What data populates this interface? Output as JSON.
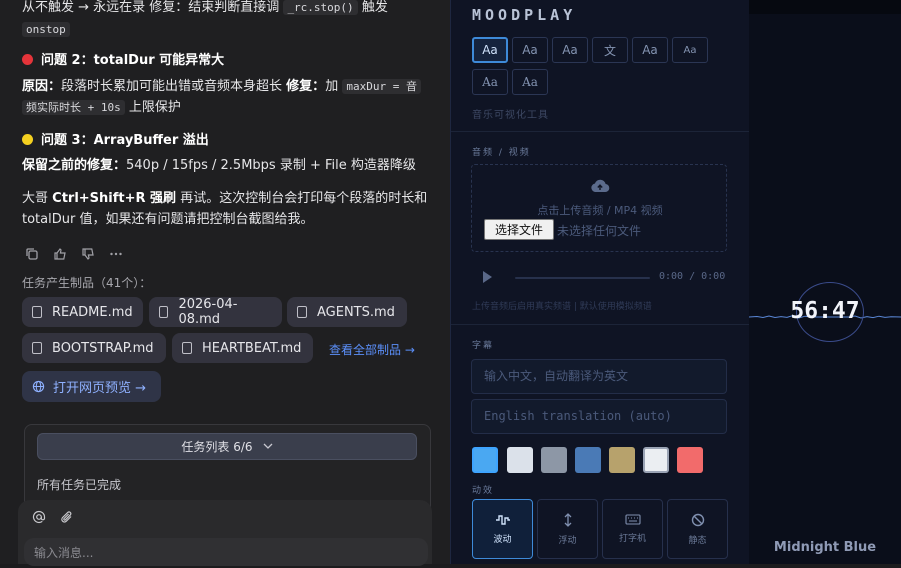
{
  "chat": {
    "line1": "从不触发 → 永远在录 修复：结束判断直接调",
    "code1": "_rc.stop()",
    "line1b": "触发",
    "code2": "onstop",
    "issue2_title": "问题 2：totalDur 可能异常大",
    "issue2_cause_label": "原因：",
    "issue2_cause": "段落时长累加可能出错或音频本身超长",
    "issue2_fix_label": "修复：",
    "issue2_fix_pre": "加",
    "issue2_code": "maxDur = 音",
    "issue2_code_b": "频实际时长 + 10s",
    "issue2_tail": "上限保护",
    "issue3_title": "问题 3：ArrayBuffer 溢出",
    "issue3_label": "保留之前的修复：",
    "issue3_text": "540p / 15fps / 2.5Mbps 录制 + File 构造器降级",
    "closing1_pre": "大哥",
    "closing1_keys": "Ctrl+Shift+R 强刷",
    "closing1_post": "再试。这次控制台会打印每个段落的时长和",
    "closing2": "totalDur 值，如果还有问题请把控制台截图给我。",
    "artifacts_title": "任务产生制品（41个）：",
    "artifacts": [
      "README.md",
      "2026-04-08.md",
      "AGENTS.md",
      "BOOTSTRAP.md",
      "HEARTBEAT.md"
    ],
    "view_all": "查看全部制品 →",
    "preview": "打开网页预览 →",
    "tasks_header": "任务列表 6/6",
    "tasks_done": "所有任务已完成",
    "composer_placeholder": "输入消息..."
  },
  "panel": {
    "logo": "MOODPLAY",
    "fonts": [
      "Aa",
      "Aa",
      "Aa",
      "文",
      "Aa",
      "Aa",
      "Aa",
      "Aa"
    ],
    "subtitle": "音乐可视化工具",
    "audio_section": "音频 / 视频",
    "upload_text": "点击上传音频 / MP4 视频",
    "choose_file": "选择文件",
    "no_file": "未选择任何文件",
    "time": "0:00 / 0:00",
    "upload_hint": "上传音频后启用真实频谱 | 默认使用模拟频谱",
    "subtitle_section": "字幕",
    "zh_placeholder": "输入中文，自动翻译为英文",
    "en_placeholder": "English translation (auto)",
    "swatches": [
      "#4aa8f2",
      "#dbe1ea",
      "#8d97a6",
      "#4a7ab6",
      "#b7a26c",
      "#ebeef2",
      "#f26b6b"
    ],
    "effects_section": "动效",
    "effects": [
      "波动",
      "浮动",
      "打字机",
      "静态"
    ]
  },
  "viz": {
    "clock": "56:47",
    "theme": "Midnight Blue"
  }
}
